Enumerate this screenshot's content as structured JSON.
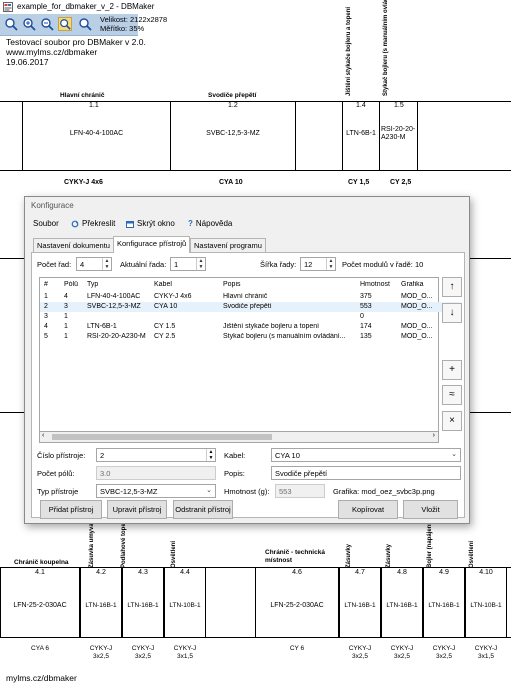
{
  "window": {
    "title": "example_for_dbmaker_v_2 - DBMaker"
  },
  "toolbar": {
    "velikost": "Velikost: 2122x2878",
    "meritko": "Měřítko: 35%"
  },
  "doc": {
    "line1": "Testovací soubor pro DBMaker v 2.0.",
    "line2": "www.mylms.cz/dbmaker",
    "line3": "19.06.2017",
    "footer": "mylms.cz/dbmaker",
    "top_labels": [
      "Hlavní chránič",
      "Svodiče přepětí"
    ],
    "top_vlabels": [
      "Jištění stykače bojleru a topení",
      "Stykač bojleru (s manuálním ovládáním)"
    ],
    "top_boxes": [
      {
        "num": "1.1",
        "name": "LFN-40-4-100AC",
        "cable": "CYKY-J 4x6"
      },
      {
        "num": "1.2",
        "name": "SVBC-12,5-3-MZ",
        "cable": "CYA 10"
      },
      {
        "num": "1.4",
        "name": "LTN-6B-1",
        "cable": "CY 1,5"
      },
      {
        "num": "1.5",
        "name": "RSI-20-20-A230-M",
        "cable": "CY 2,5"
      }
    ],
    "bottom_labels": [
      "Chránič koupelna",
      "Chránič - technická místnost"
    ],
    "bottom_vlabels_left": [
      "Zásuvka umyvadlo",
      "Podlahové topení + žebřík",
      "Osvětlení"
    ],
    "bottom_vlabels_right": [
      "Zásuvky",
      "Zásuvky",
      "Bojler (napájení stykače)",
      "Osvětlení"
    ],
    "bottom_boxes": [
      {
        "num": "4.1",
        "name": "LFN-25-2-030AC",
        "cable": "CYA 6"
      },
      {
        "num": "4.2",
        "name": "LTN-16B-1",
        "cable": "CYKY-J 3x2,5"
      },
      {
        "num": "4.3",
        "name": "LTN-16B-1",
        "cable": "CYKY-J 3x2,5"
      },
      {
        "num": "4.4",
        "name": "LTN-10B-1",
        "cable": "CYKY-J 3x1,5"
      },
      {
        "num": "4.6",
        "name": "LFN-25-2-030AC",
        "cable": "CY 6"
      },
      {
        "num": "4.7",
        "name": "LTN-16B-1",
        "cable": "CYKY-J 3x2,5"
      },
      {
        "num": "4.8",
        "name": "LTN-16B-1",
        "cable": "CYKY-J 3x2,5"
      },
      {
        "num": "4.9",
        "name": "LTN-16B-1",
        "cable": "CYKY-J 3x2,5"
      },
      {
        "num": "4.10",
        "name": "LTN-10B-1",
        "cable": "CYKY-J 3x1,5"
      }
    ]
  },
  "dialog": {
    "title": "Konfigurace",
    "menu": {
      "soubor": "Soubor",
      "prekreslit": "Překreslit",
      "skryt": "Skrýt okno",
      "napoveda": "Nápověda"
    },
    "tabs": [
      "Nastavení dokumentu",
      "Konfigurace přístrojů",
      "Nastavení programu"
    ],
    "pocet_rad_label": "Počet řad:",
    "pocet_rad": "4",
    "aktualni_rada_label": "Aktuální řada:",
    "aktualni_rada": "1",
    "sirka_rady_label": "Šířka řady:",
    "sirka_rady": "12",
    "pocet_modulu": "Počet modulů v řadě: 10",
    "columns": [
      "#",
      "Pólů",
      "Typ",
      "Kabel",
      "Popis",
      "Hmotnost",
      "Grafika"
    ],
    "rows": [
      [
        "1",
        "4",
        "LFN-40-4-100AC",
        "CYKY-J 4x6",
        "Hlavní chránič",
        "375",
        "MOD_O..."
      ],
      [
        "2",
        "3",
        "SVBC-12,5-3-MZ",
        "CYA 10",
        "Svodiče přepětí",
        "553",
        "MOD_O..."
      ],
      [
        "3",
        "1",
        "",
        "",
        "",
        "0",
        ""
      ],
      [
        "4",
        "1",
        "LTN-6B-1",
        "CY 1.5",
        "Jištění stykače bojleru a topení",
        "174",
        "MOD_O..."
      ],
      [
        "5",
        "1",
        "RSI-20-20-A230-M",
        "CY 2.5",
        "Stykač bojleru (s manuálním ovládání...",
        "135",
        "MOD_O..."
      ]
    ],
    "side_buttons": [
      "↑",
      "↓",
      "+",
      "≈",
      "×"
    ],
    "cislo_label": "Číslo přístroje:",
    "cislo": "2",
    "kabel_label": "Kabel:",
    "kabel": "CYA 10",
    "polu_label": "Počet pólů:",
    "polu": "3.0",
    "popis_label": "Popis:",
    "popis": "Svodiče přepětí",
    "typ_label": "Typ přístroje",
    "typ": "SVBC-12,5-3-MZ",
    "hmotnost_label": "Hmotnost (g):",
    "hmotnost": "553",
    "grafika": "Grafika: mod_oez_svbc3p.png",
    "buttons": {
      "pridat": "Přidat přístroj",
      "upravit": "Upravit přístroj",
      "odstranit": "Odstranit přístroj",
      "kopirovat": "Kopírovat",
      "vlozit": "Vložit"
    }
  }
}
